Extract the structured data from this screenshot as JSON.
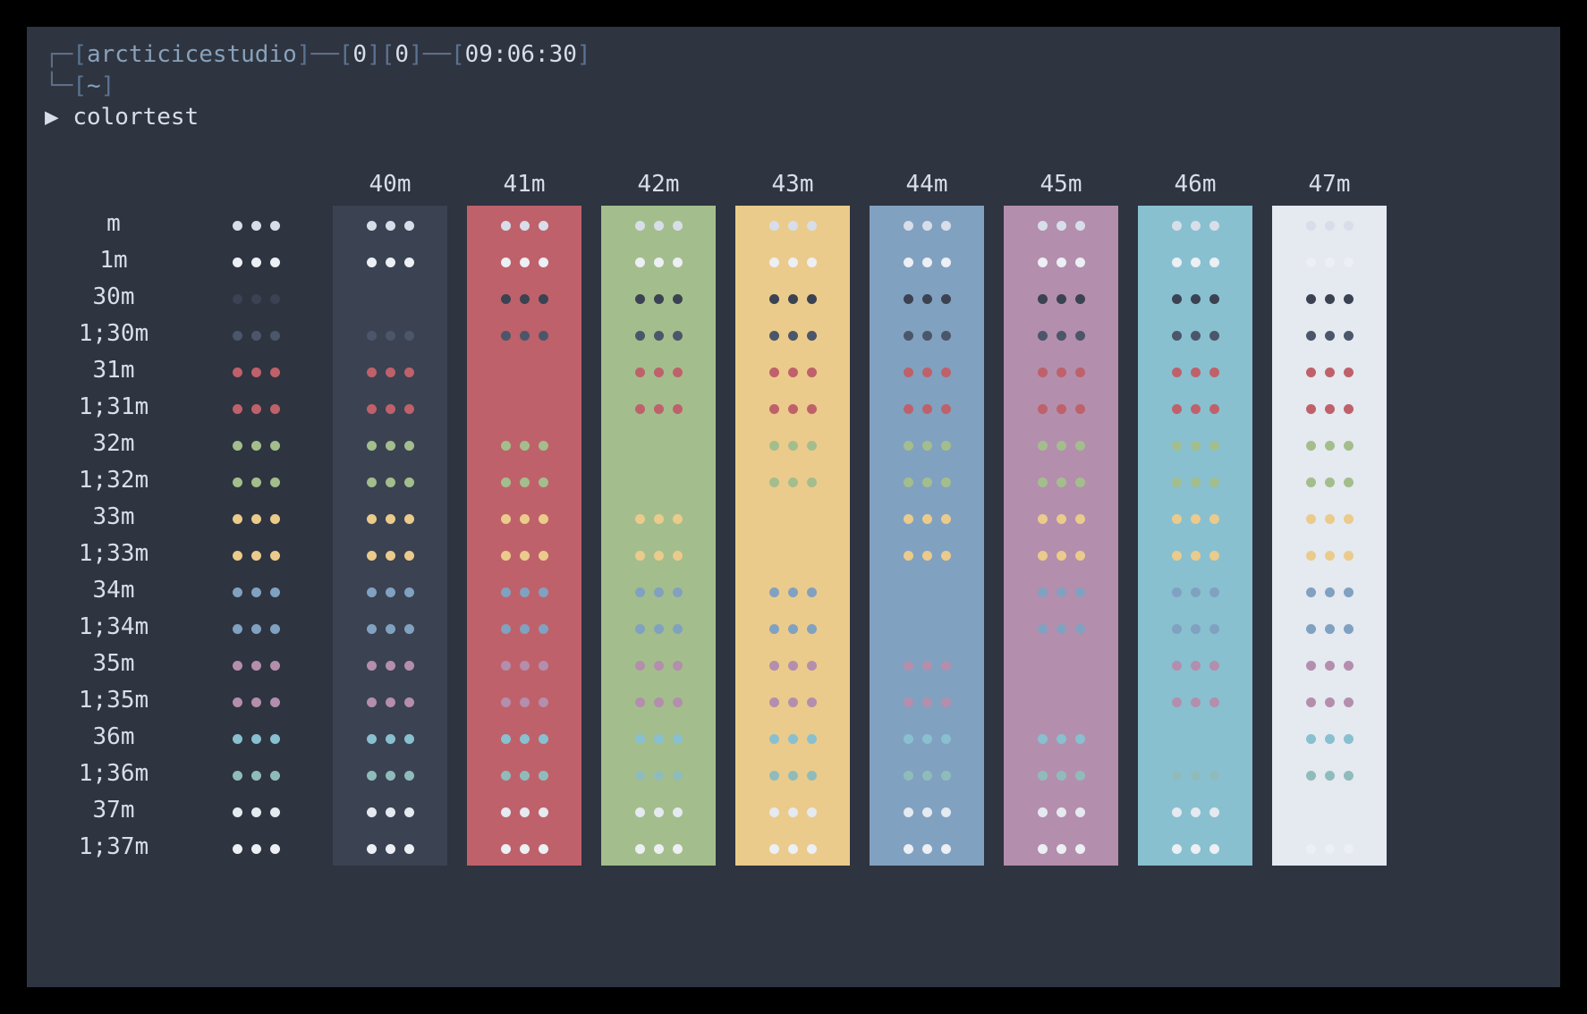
{
  "prompt": {
    "user": "arcticicestudio",
    "status1": "0",
    "status2": "0",
    "time": "09:06:30",
    "cwd": "~",
    "arrow": "▶",
    "command": "colortest"
  },
  "palette": {
    "bg": "#2e3440",
    "fg_default": "#d8dee9",
    "black": "#3b4252",
    "b_black": "#4c566a",
    "red": "#bf616a",
    "b_red": "#bf616a",
    "green": "#a3be8c",
    "b_green": "#a3be8c",
    "yellow": "#ebcb8b",
    "b_yellow": "#ebcb8b",
    "blue": "#81a1c1",
    "b_blue": "#81a1c1",
    "magenta": "#b48ead",
    "b_magenta": "#b48ead",
    "cyan": "#88c0d0",
    "b_cyan": "#8fbcbb",
    "white": "#e5e9f0",
    "b_white": "#eceff4"
  },
  "bg_columns": [
    {
      "label": "",
      "key": "none",
      "color": null
    },
    {
      "label": "40m",
      "key": "black",
      "color": "#3b4252"
    },
    {
      "label": "41m",
      "key": "red",
      "color": "#bf616a"
    },
    {
      "label": "42m",
      "key": "green",
      "color": "#a3be8c"
    },
    {
      "label": "43m",
      "key": "yellow",
      "color": "#ebcb8b"
    },
    {
      "label": "44m",
      "key": "blue",
      "color": "#81a1c1"
    },
    {
      "label": "45m",
      "key": "magenta",
      "color": "#b48ead"
    },
    {
      "label": "46m",
      "key": "cyan",
      "color": "#88c0d0"
    },
    {
      "label": "47m",
      "key": "white",
      "color": "#e5e9f0"
    }
  ],
  "fg_rows": [
    {
      "label": "m",
      "color": "#d8dee9"
    },
    {
      "label": "1m",
      "color": "#eceff4"
    },
    {
      "label": "30m",
      "color": "#3b4252"
    },
    {
      "label": "1;30m",
      "color": "#4c566a"
    },
    {
      "label": "31m",
      "color": "#bf616a"
    },
    {
      "label": "1;31m",
      "color": "#bf616a"
    },
    {
      "label": "32m",
      "color": "#a3be8c"
    },
    {
      "label": "1;32m",
      "color": "#a3be8c"
    },
    {
      "label": "33m",
      "color": "#ebcb8b"
    },
    {
      "label": "1;33m",
      "color": "#ebcb8b"
    },
    {
      "label": "34m",
      "color": "#81a1c1"
    },
    {
      "label": "1;34m",
      "color": "#81a1c1"
    },
    {
      "label": "35m",
      "color": "#b48ead"
    },
    {
      "label": "1;35m",
      "color": "#b48ead"
    },
    {
      "label": "36m",
      "color": "#88c0d0"
    },
    {
      "label": "1;36m",
      "color": "#8fbcbb"
    },
    {
      "label": "37m",
      "color": "#e5e9f0"
    },
    {
      "label": "1;37m",
      "color": "#eceff4"
    }
  ]
}
